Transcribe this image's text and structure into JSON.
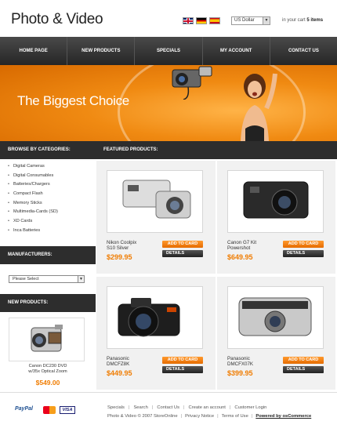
{
  "header": {
    "logo": "Photo & Video",
    "flags": [
      "uk-flag-icon",
      "germany-flag-icon",
      "spain-flag-icon"
    ],
    "currency": "US Dollar",
    "cart_prefix": "in your cart",
    "cart_count": "5 items"
  },
  "nav": {
    "items": [
      "HOME PAGE",
      "NEW PRODUCTS",
      "SPECIALS",
      "MY ACCOUNT",
      "CONTACT US"
    ]
  },
  "banner": {
    "title": "The Biggest Choice"
  },
  "sidebar": {
    "categories_title": "BROWSE BY CATEGORIES:",
    "categories": [
      "Digital Cameras",
      "Digital Consumables",
      "Batteries/Chargers",
      "Compact Flash",
      "Memory Sticks",
      "Multimedia-Cards (SD)",
      "XD Cards",
      "Inca Batteries"
    ],
    "manufacturers_title": "MANUFACTURERS:",
    "manufacturers_select": "Please Select",
    "new_products_title": "NEW PRODUCTS:",
    "new_product": {
      "name_line1": "Canon DC230 DVD",
      "name_line2": "w/35x Optical Zoom",
      "price": "$549.00"
    }
  },
  "main": {
    "title": "FEATURED PRODUCTS:",
    "add_label": "ADD TO CARD",
    "details_label": "DETAILS",
    "products": [
      {
        "name_line1": "Nikon Coolpix",
        "name_line2": "S10 Silver",
        "price": "$299.95"
      },
      {
        "name_line1": "Canon G7 Kit",
        "name_line2": "Powershot",
        "price": "$649.95"
      },
      {
        "name_line1": "Panasonic",
        "name_line2": "DMCFZ8K",
        "price": "$449.95"
      },
      {
        "name_line1": "Panasonic",
        "name_line2": "DMCFX07K",
        "price": "$399.95"
      }
    ]
  },
  "footer": {
    "paypal": "PayPal",
    "visa": "VISA",
    "links": [
      "Specials",
      "Search",
      "Contact Us",
      "Create an account",
      "Customer Login"
    ],
    "copyright": "Photo & Video © 2007 StoreOnline",
    "privacy": "Privacy Notice",
    "terms": "Terms of Use",
    "powered": "Powered by osCommerce"
  },
  "colors": {
    "accent": "#f07c00",
    "dark": "#2d2d2d"
  }
}
